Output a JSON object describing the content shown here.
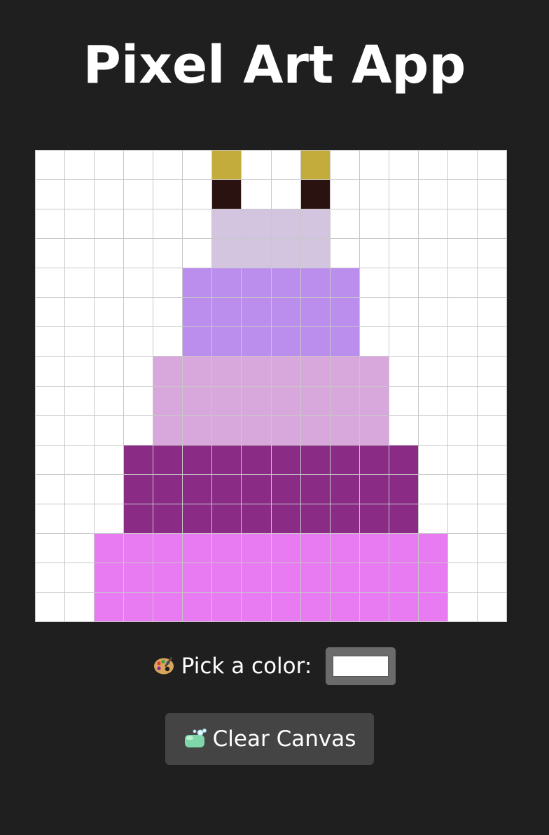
{
  "app": {
    "title": "Pixel Art App"
  },
  "colors": {
    "background": "#1f1f1f",
    "empty": "#ffffff",
    "grid_line": "#c8c8c8",
    "palette": {
      "W": "#ffffff",
      "G": "#c4ac3c",
      "D": "#2a1210",
      "L": "#d3c5e0",
      "P": "#bb8eee",
      "K": "#d8a7dc",
      "M": "#8a2c86",
      "F": "#e87af2"
    }
  },
  "canvas": {
    "columns": 16,
    "rows": [
      "WWWWWWGWWGWWWWWW",
      "WWWWWWDWWDWWWWWW",
      "WWWWWWLLLLWWWWWW",
      "WWWWWWLLLLWWWWWW",
      "WWWWWPPPPPPWWWWW",
      "WWWWWPPPPPPWWWWW",
      "WWWWWPPPPPPWWWWW",
      "WWWWKKKKKKKKWWWW",
      "WWWWKKKKKKKKWWWW",
      "WWWWKKKKKKKKWWWW",
      "WWWMMMMMMMMMMWWW",
      "WWWMMMMMMMMMMWWW",
      "WWWMMMMMMMMMMWWW",
      "WWFFFFFFFFFFFFWW",
      "WWFFFFFFFFFFFFWW",
      "WWFFFFFFFFFFFFWW"
    ]
  },
  "color_picker": {
    "icon": "palette-icon",
    "label": "Pick a color:",
    "value": "#ffffff"
  },
  "clear_button": {
    "icon": "soap-icon",
    "label": "Clear Canvas"
  }
}
